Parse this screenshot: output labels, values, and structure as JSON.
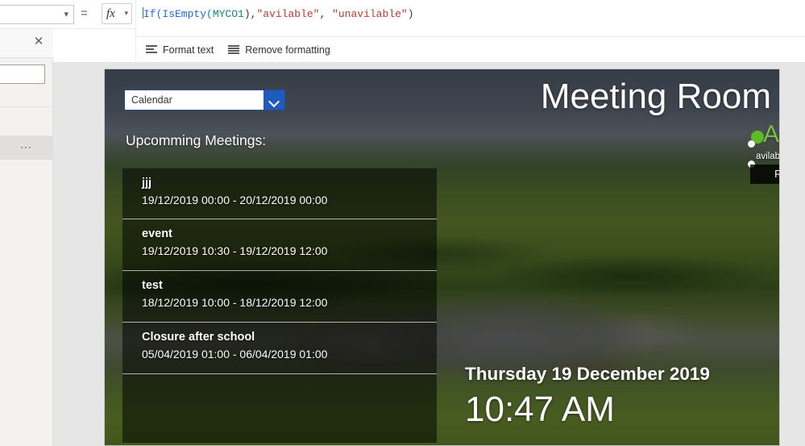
{
  "formula_bar": {
    "property_value": "",
    "equals_sign": "=",
    "fx_label": "fx",
    "formula_parts": {
      "fn_if": "If(",
      "fn_isempty": "IsEmpty(",
      "var": "MYCO1",
      "mid": "),",
      "str1": "\"avilable\"",
      "comma": ", ",
      "str2": "\"unavilable\"",
      "close": ")"
    },
    "formula_full": "If(IsEmpty(MYCO1),\"avilable\", \"unavilable\")"
  },
  "format_toolbar": {
    "format_text": "Format text",
    "remove_formatting": "Remove formatting"
  },
  "left_panel": {
    "close_glyph": "✕",
    "overflow_glyph": "⋯",
    "search_value": ""
  },
  "app": {
    "title": "Meeting Room",
    "calendar_dropdown": {
      "selected": "Calendar",
      "chevron": "chevron-down"
    },
    "upcoming_heading": "Upcomming Meetings:",
    "meetings": [
      {
        "title": "jjj",
        "time": "19/12/2019 00:00 - 20/12/2019 00:00"
      },
      {
        "title": "event",
        "time": "19/12/2019 10:30 - 19/12/2019 12:00"
      },
      {
        "title": "test",
        "time": "18/12/2019 10:00 - 18/12/2019 12:00"
      },
      {
        "title": "Closure after school",
        "time": "05/04/2019 01:00 - 06/04/2019 01:00"
      }
    ],
    "status": {
      "label": "Available",
      "selected_text_value": "avilable",
      "dot_color": "#5fbb24",
      "label_color": "#77c043"
    },
    "report_button": "Report an Issue",
    "date": "Thursday 19 December 2019",
    "time": "10:47 AM"
  }
}
